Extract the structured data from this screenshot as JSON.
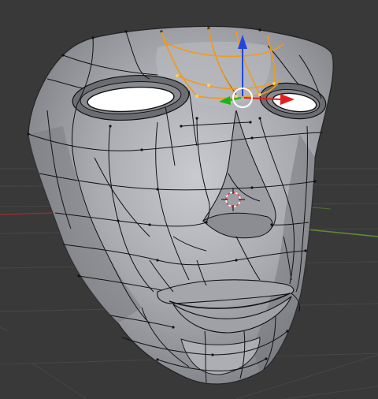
{
  "viewport": {
    "background": "#393939",
    "grid_color": "#4a4a4a",
    "axis_x_color": "#8f2f2f",
    "axis_y_color": "#5f8f35"
  },
  "mesh": {
    "surface_color": "#a9abb0",
    "wire_color": "#111111",
    "selected_edge_color": "#f29a1b"
  },
  "gizmo": {
    "x_color": "#e31f1f",
    "y_color": "#19b319",
    "z_color": "#2045e0",
    "center_ring_color": "#ffffff",
    "icon_names": [
      "transform-gizmo-icon",
      "3d-cursor-icon"
    ]
  },
  "cursor": {
    "color_a": "#ff3b3b",
    "color_b": "#ffffff"
  }
}
